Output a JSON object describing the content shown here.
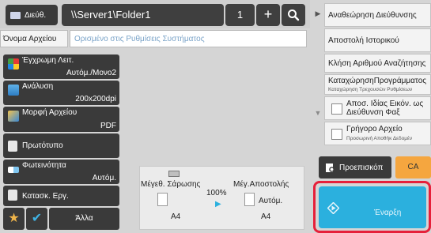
{
  "address_bar": {
    "address_book_label": "Διεύθ.",
    "address_value": "\\\\Server1\\Folder1",
    "count": "1",
    "add_symbol": "+"
  },
  "filename": {
    "label": "Όνομα Αρχείου",
    "placeholder": "Ορισμένο στις Ρυθμίσεις Συστήματος"
  },
  "settings": [
    {
      "label": "Έγχρωμη Λειτ.",
      "value": "Αυτόμ./Μονο2",
      "icon": "color-mode-icon"
    },
    {
      "label": "Ανάλυση",
      "value": "200x200dpi",
      "icon": "resolution-icon"
    },
    {
      "label": "Μορφή Αρχείου",
      "value": "PDF",
      "icon": "file-format-icon"
    },
    {
      "label": "Πρωτότυπο",
      "value": "",
      "icon": "original-icon"
    },
    {
      "label": "Φωτεινότητα",
      "value": "Αυτόμ.",
      "icon": "exposure-icon"
    },
    {
      "label": "Κατασκ. Εργ.",
      "value": "",
      "icon": "job-build-icon"
    }
  ],
  "bottom_bar": {
    "other_label": "Άλλα"
  },
  "preview_panel": {
    "scan_size_label": "Μέγεθ. Σάρωσης",
    "scan_size_value": "A4",
    "ratio": "100%",
    "send_size_label": "Μέγ.Αποστολής",
    "send_size_mode": "Αυτόμ.",
    "send_size_value": "A4"
  },
  "right_menu": {
    "items": [
      {
        "label": "Αναθεώρηση Διεύθυνσης"
      },
      {
        "label": "Αποστολή Ιστορικού"
      },
      {
        "label": "Κλήση Αριθμού Αναζήτησης"
      },
      {
        "label": "ΚαταχώρησηΠρογράμματος",
        "sub": "Καταχώρηση Τρεχουσών Ρυθμίσεων"
      }
    ],
    "checkboxes": [
      {
        "label": "Αποσ. Ιδίας Εικόν. ως Διεύθυνση Φαξ",
        "checked": false
      },
      {
        "label": "Γρήγορο Αρχείο",
        "sub": "Προσωρινή Αποθήκ Δεδομέν",
        "checked": false
      }
    ]
  },
  "actions": {
    "preview_label": "Προεπισκόπ",
    "ca_label": "CA",
    "start_label": "Έναρξη"
  },
  "colors": {
    "accent_blue": "#2bb0de",
    "start_outline": "#e6203a",
    "ca_orange": "#f5a63f",
    "dark_button": "#3a3a3a"
  }
}
